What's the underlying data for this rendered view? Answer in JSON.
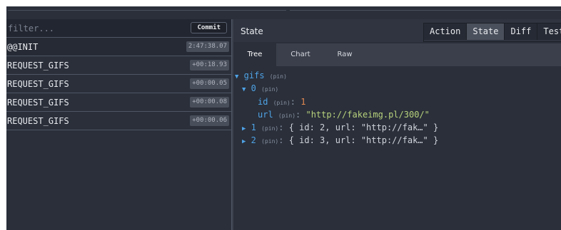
{
  "left": {
    "filter_placeholder": "filter...",
    "commit_label": "Commit",
    "actions": [
      {
        "name": "@@INIT",
        "time": "2:47:38.07"
      },
      {
        "name": "REQUEST_GIFS",
        "time": "+00:18.93"
      },
      {
        "name": "REQUEST_GIFS",
        "time": "+00:00.05"
      },
      {
        "name": "REQUEST_GIFS",
        "time": "+00:00.08"
      },
      {
        "name": "REQUEST_GIFS",
        "time": "+00:00.06"
      }
    ]
  },
  "monitor": {
    "title": "State",
    "tabs": [
      "Action",
      "State",
      "Diff",
      "Test"
    ],
    "active_tab": "State",
    "sub_tabs": [
      "Tree",
      "Chart",
      "Raw"
    ],
    "active_sub_tab": "Tree"
  },
  "tree": {
    "root_key": "gifs",
    "pin": "(pin)",
    "colon": ":",
    "item0_key": "0",
    "item0_id_key": "id",
    "item0_id_value": "1",
    "item0_url_key": "url",
    "item0_url_value": "\"http://fakeimg.pl/300/\"",
    "item1_key": "1",
    "item1_summary": "{ id: 2, url: \"http://fak…\" }",
    "item2_key": "2",
    "item2_summary": "{ id: 3, url: \"http://fak…\" }"
  },
  "colors": {
    "background": "#2a2f3a",
    "key": "#4fa3e6",
    "number": "#e58a52",
    "string": "#b8d27c"
  },
  "icons": {
    "expanded": "triangle-down-icon",
    "collapsed": "triangle-right-icon"
  }
}
